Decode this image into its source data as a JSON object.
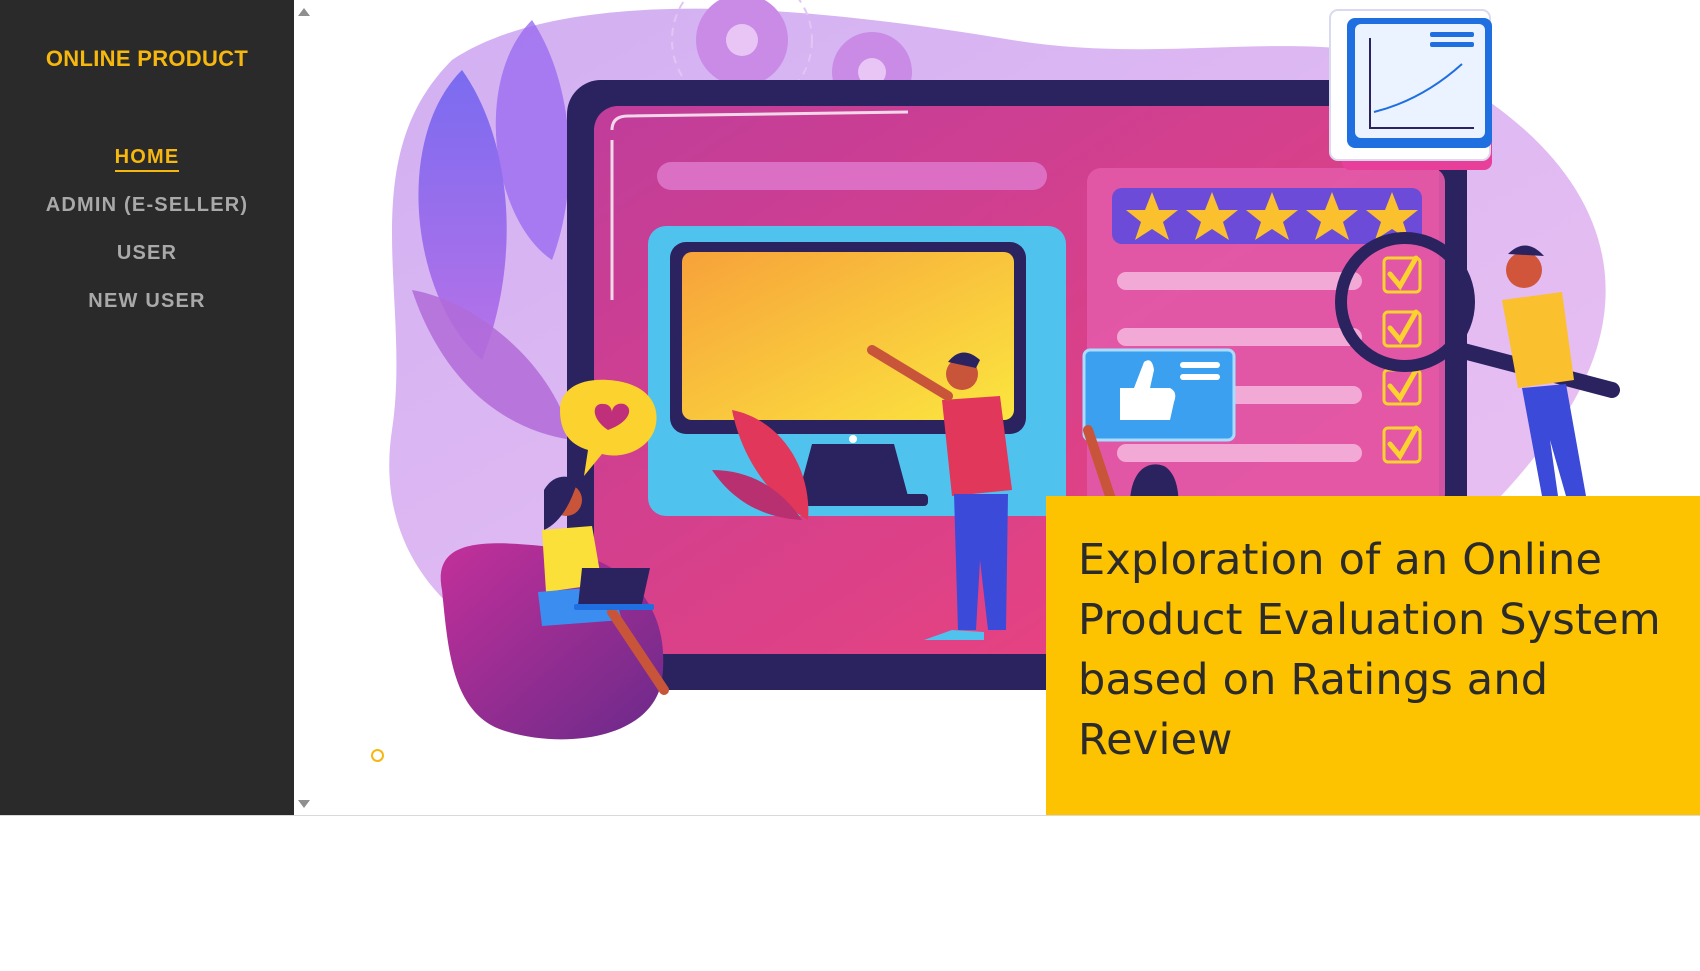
{
  "brand": {
    "title": "ONLINE PRODUCT"
  },
  "nav": {
    "items": [
      {
        "label": "HOME",
        "active": true
      },
      {
        "label": "ADMIN (E-SELLER)",
        "active": false
      },
      {
        "label": "USER",
        "active": false
      },
      {
        "label": "NEW USER",
        "active": false
      }
    ]
  },
  "hero": {
    "caption": "Exploration of an Online Product Evaluation System based on Ratings and Review",
    "rating_stars": 5,
    "slide_indicator_count": 1
  },
  "colors": {
    "sidebar_bg": "#2a2a2a",
    "accent": "#f6b80e",
    "nav_text": "#a9a9a9",
    "caption_bg": "#fdc300",
    "caption_text": "#2b2b2b"
  },
  "icons": {
    "scroll_up": "triangle-up-icon",
    "scroll_down": "triangle-down-icon",
    "slide_dot": "circle-outline-icon"
  }
}
